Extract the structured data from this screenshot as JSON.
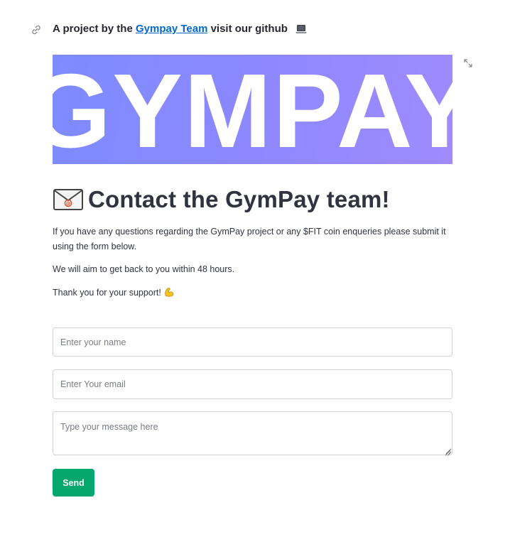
{
  "header": {
    "prefix": "A project by the ",
    "link_text": "Gympay Team",
    "suffix": " visit our github",
    "laptop_icon": "laptop-icon",
    "link_icon": "link-icon"
  },
  "banner": {
    "text": "GYMPAY",
    "gradient_start": "#7e8bff",
    "gradient_end": "#a08aff"
  },
  "expand_icon": "expand-icon",
  "main": {
    "envelope_icon": "envelope-icon",
    "title": "Contact the GymPay team!",
    "paragraphs": [
      "If you have any questions regarding the GymPay project or any $FIT coin enqueries please submit it using the form below.",
      "We will aim to get back to you within 48 hours.",
      "Thank you for your support!"
    ],
    "muscle_icon": "flexed-biceps-icon"
  },
  "form": {
    "name_placeholder": "Enter your name",
    "email_placeholder": "Enter Your email",
    "message_placeholder": "Type your message here",
    "send_label": "Send"
  },
  "colors": {
    "link": "#0068c9",
    "send_button": "#04a86f",
    "text": "#31333f",
    "border": "#d0d2d8"
  }
}
